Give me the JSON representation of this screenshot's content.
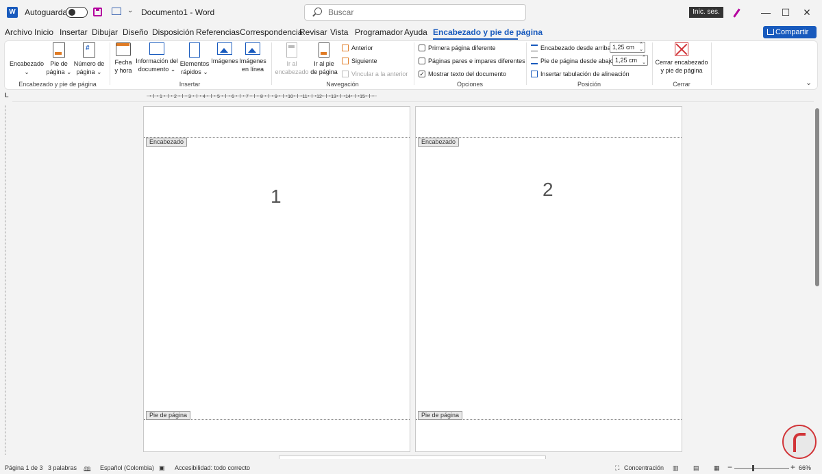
{
  "titlebar": {
    "app_logo": "W",
    "autosave_label": "Autoguardado",
    "doc_title": "Documento1  -  Word",
    "search_placeholder": "Buscar",
    "signin_label": "Inic. ses.",
    "minimize": "—",
    "maximize": "☐",
    "close": "✕"
  },
  "tabs": [
    "Archivo",
    "Inicio",
    "Insertar",
    "Dibujar",
    "Diseño",
    "Disposición",
    "Referencias",
    "Correspondencia",
    "Revisar",
    "Vista",
    "Programador",
    "Ayuda",
    "Encabezado y pie de página"
  ],
  "active_tab": "Encabezado y pie de página",
  "share_label": "Compartir",
  "ribbon": {
    "group1": {
      "label": "Encabezado y pie de página",
      "buttons": [
        {
          "line1": "Encabezado",
          "line2": "⌄"
        },
        {
          "line1": "Pie de",
          "line2": "página ⌄"
        },
        {
          "line1": "Número de",
          "line2": "página ⌄"
        }
      ]
    },
    "group2": {
      "label": "Insertar",
      "buttons": [
        {
          "line1": "Fecha",
          "line2": "y hora"
        },
        {
          "line1": "Información del",
          "line2": "documento ⌄"
        },
        {
          "line1": "Elementos",
          "line2": "rápidos ⌄"
        },
        {
          "line1": "Imágenes",
          "line2": ""
        },
        {
          "line1": "Imágenes",
          "line2": "en línea"
        }
      ]
    },
    "group3": {
      "label": "Navegación",
      "buttons": [
        {
          "line1": "Ir al",
          "line2": "encabezado"
        },
        {
          "line1": "Ir al pie",
          "line2": "de página"
        }
      ],
      "previous": "Anterior",
      "next": "Siguiente",
      "link_previous": "Vincular a la anterior"
    },
    "group4": {
      "label": "Opciones",
      "different_first": "Primera página diferente",
      "odd_even": "Páginas pares e impares diferentes",
      "show_text": "Mostrar texto del documento"
    },
    "group5": {
      "label": "Posición",
      "header_from_top": "Encabezado desde arriba:",
      "header_value": "1,25 cm",
      "footer_from_bottom": "Pie de página desde abajo:",
      "footer_value": "1,25 cm",
      "insert_tab": "Insertar tabulación de alineación"
    },
    "group6": {
      "label": "Cerrar",
      "close_line1": "Cerrar encabezado",
      "close_line2": "y pie de página"
    }
  },
  "ruler": {
    "labels": [
      "1",
      "2",
      "3",
      "4",
      "5",
      "6",
      "7",
      "8",
      "9",
      "10",
      "11",
      "12",
      "13",
      "14",
      "15"
    ]
  },
  "pages": [
    {
      "header_tag": "Encabezado",
      "footer_tag": "Pie de página",
      "number": "1"
    },
    {
      "header_tag": "Encabezado",
      "footer_tag": "Pie de página",
      "number": "2"
    }
  ],
  "status": {
    "page": "Página 1 de 3",
    "words": "3 palabras",
    "language": "Español (Colombia)",
    "accessibility": "Accesibilidad: todo correcto",
    "focus": "Concentración",
    "zoom_minus": "−",
    "zoom_plus": "+",
    "zoom": "66%"
  },
  "colors": {
    "accent": "#185abd",
    "header_orange": "#e07b24",
    "close_red": "#d13438"
  }
}
